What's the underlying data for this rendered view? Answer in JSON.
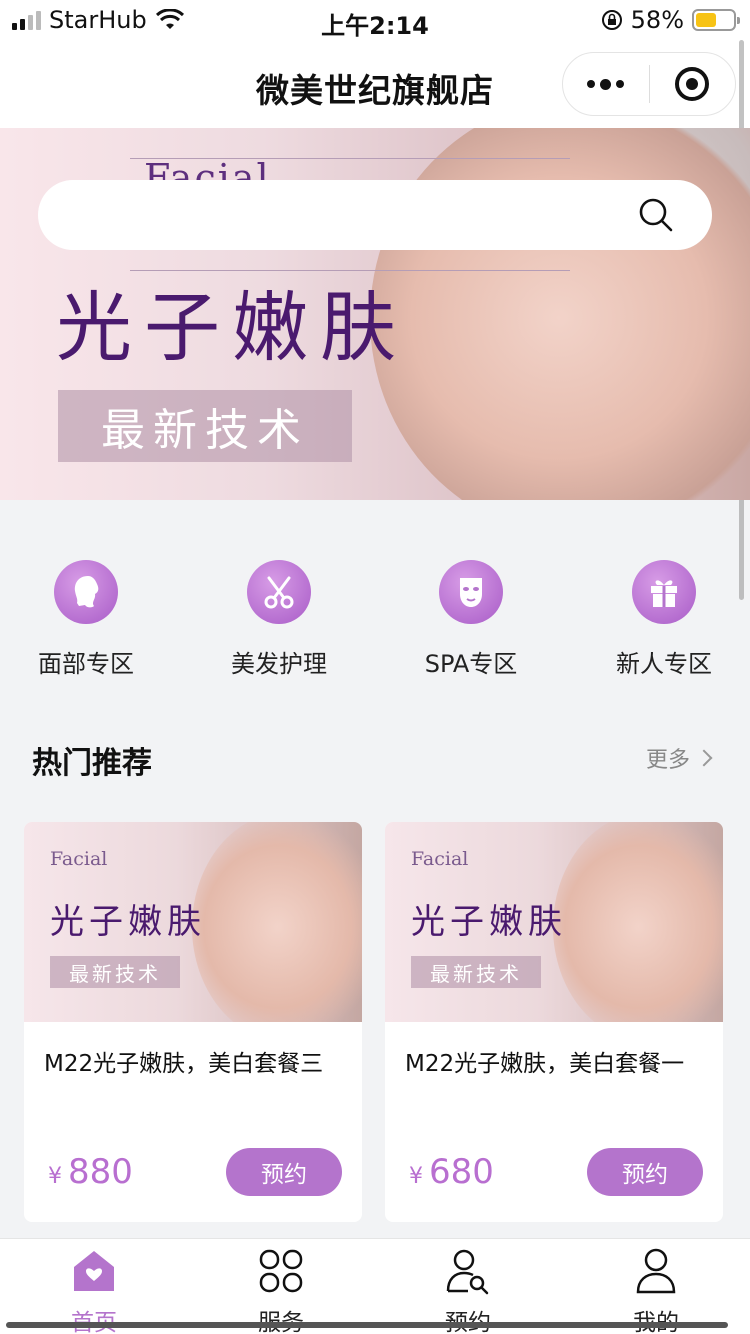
{
  "status": {
    "carrier": "StarHub",
    "time": "上午2:14",
    "battery": "58%",
    "battery_level": 0.55
  },
  "nav": {
    "title": "微美世纪旗舰店"
  },
  "banner": {
    "script_text": "Facial",
    "headline": "光子嫩肤",
    "tag": "最新技术"
  },
  "categories": [
    {
      "label": "面部专区",
      "icon": "face-profile-icon"
    },
    {
      "label": "美发护理",
      "icon": "scissors-icon"
    },
    {
      "label": "SPA专区",
      "icon": "face-mask-icon"
    },
    {
      "label": "新人专区",
      "icon": "gift-icon"
    }
  ],
  "section": {
    "title": "热门推荐",
    "more": "更多"
  },
  "products": [
    {
      "img_script": "Facial",
      "img_headline": "光子嫩肤",
      "img_tag": "最新技术",
      "name": "M22光子嫩肤，美白套餐三",
      "currency": "¥",
      "price": "880",
      "button": "预约"
    },
    {
      "img_script": "Facial",
      "img_headline": "光子嫩肤",
      "img_tag": "最新技术",
      "name": "M22光子嫩肤，美白套餐一",
      "currency": "¥",
      "price": "680",
      "button": "预约"
    }
  ],
  "tabs": [
    {
      "label": "首页",
      "icon": "home-icon",
      "active": true
    },
    {
      "label": "服务",
      "icon": "grid-icon",
      "active": false
    },
    {
      "label": "预约",
      "icon": "user-search-icon",
      "active": false
    },
    {
      "label": "我的",
      "icon": "person-icon",
      "active": false
    }
  ],
  "colors": {
    "accent": "#b474cc",
    "title_purple": "#4a1a6e",
    "battery": "#f7c315"
  }
}
